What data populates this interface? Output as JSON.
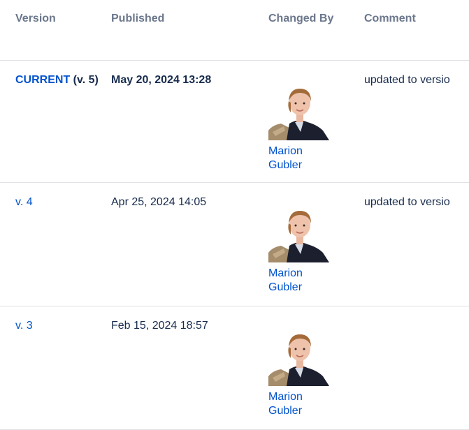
{
  "headers": {
    "version": "Version",
    "published": "Published",
    "changed_by": "Changed By",
    "comment": "Comment"
  },
  "rows": [
    {
      "version_link": "CURRENT",
      "version_suffix": " (v. 5)",
      "published": "May 20, 2024 13:28",
      "user": "Marion Gubler",
      "comment": "updated to versio"
    },
    {
      "version_link": "v. 4",
      "published": "Apr 25, 2024 14:05",
      "user": "Marion Gubler",
      "comment": "updated to versio"
    },
    {
      "version_link": "v. 3",
      "published": "Feb 15, 2024 18:57",
      "user": "Marion Gubler",
      "comment": ""
    }
  ],
  "avatar_icon": "user-avatar-photo",
  "colors": {
    "link": "#0052cc",
    "header_text": "#6b778c",
    "divider": "#dfe1e6"
  }
}
